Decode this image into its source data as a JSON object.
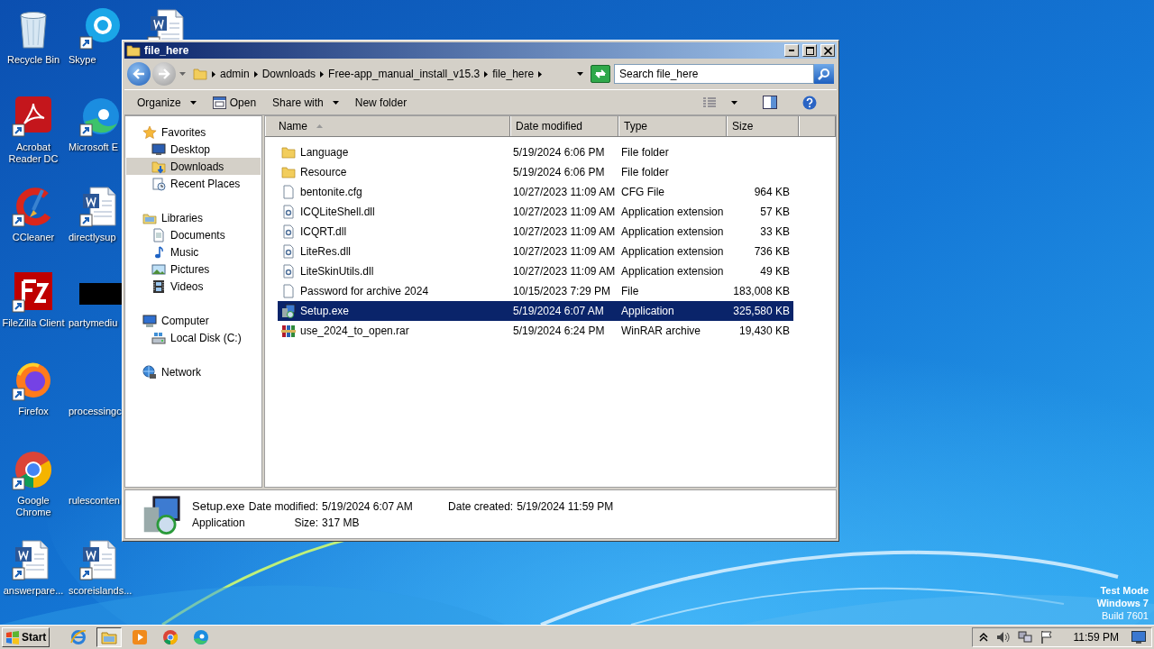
{
  "desktop": {
    "icons": [
      {
        "label": "Recycle Bin",
        "kind": "trash"
      },
      {
        "label": "Acrobat Reader DC",
        "kind": "acrobat"
      },
      {
        "label": "CCleaner",
        "kind": "ccleaner"
      },
      {
        "label": "FileZilla Client",
        "kind": "filezilla"
      },
      {
        "label": "Firefox",
        "kind": "firefox"
      },
      {
        "label": "Google Chrome",
        "kind": "chrome"
      },
      {
        "label": "answerpare...",
        "kind": "word"
      },
      {
        "label": "Skype",
        "kind": "skype"
      },
      {
        "label": "Microsoft E",
        "kind": "edge"
      },
      {
        "label": "directlysup",
        "kind": "word"
      },
      {
        "label": "partymediu",
        "kind": "black"
      },
      {
        "label": "processingc",
        "kind": "none"
      },
      {
        "label": "rulesconten",
        "kind": "none"
      },
      {
        "label": "scoreislands...",
        "kind": "word"
      },
      {
        "kind": "word"
      }
    ],
    "notice": [
      "Test Mode",
      "Windows 7",
      "Build 7601"
    ]
  },
  "window": {
    "title": "file_here",
    "address": [
      "admin",
      "Downloads",
      "Free-app_manual_install_v15.3",
      "file_here"
    ],
    "search": {
      "placeholder": "Search file_here"
    },
    "toolbar": [
      {
        "label": "Organize",
        "has_menu": true,
        "kind": "text"
      },
      {
        "label": "Open",
        "has_menu": false,
        "kind": "open"
      },
      {
        "label": "Share with",
        "has_menu": true,
        "kind": "text"
      },
      {
        "label": "New folder",
        "has_menu": false,
        "kind": "text"
      }
    ],
    "sidebar": [
      {
        "label": "Favorites",
        "kind": "star",
        "selected": false,
        "children": [
          {
            "label": "Desktop",
            "kind": "desktop",
            "selected": false
          },
          {
            "label": "Downloads",
            "kind": "downloads",
            "selected": true
          },
          {
            "label": "Recent Places",
            "kind": "recent",
            "selected": false
          }
        ]
      },
      {
        "label": "Libraries",
        "kind": "libraries",
        "selected": false,
        "children": [
          {
            "label": "Documents",
            "kind": "documents",
            "selected": false
          },
          {
            "label": "Music",
            "kind": "music",
            "selected": false
          },
          {
            "label": "Pictures",
            "kind": "pictures",
            "selected": false
          },
          {
            "label": "Videos",
            "kind": "videos",
            "selected": false
          }
        ]
      },
      {
        "label": "Computer",
        "kind": "computer",
        "selected": false,
        "children": [
          {
            "label": "Local Disk (C:)",
            "kind": "disk",
            "selected": false
          }
        ]
      },
      {
        "label": "Network",
        "kind": "network",
        "selected": false
      }
    ],
    "columns": [
      {
        "label": "Name",
        "sorted": true
      },
      {
        "label": "Date modified",
        "sorted": false
      },
      {
        "label": "Type",
        "sorted": false
      },
      {
        "label": "Size",
        "sorted": false
      }
    ],
    "rows": [
      {
        "name": "Language",
        "date": "5/19/2024 6:06 PM",
        "type": "File folder",
        "kind": "folder",
        "selected": false
      },
      {
        "name": "Resource",
        "date": "5/19/2024 6:06 PM",
        "type": "File folder",
        "kind": "folder",
        "selected": false
      },
      {
        "name": "bentonite.cfg",
        "date": "10/27/2023 11:09 AM",
        "type": "CFG File",
        "size": "964 KB",
        "kind": "file",
        "selected": false
      },
      {
        "name": "ICQLiteShell.dll",
        "date": "10/27/2023 11:09 AM",
        "type": "Application extension",
        "size": "57 KB",
        "kind": "dll",
        "selected": false
      },
      {
        "name": "ICQRT.dll",
        "date": "10/27/2023 11:09 AM",
        "type": "Application extension",
        "size": "33 KB",
        "kind": "dll",
        "selected": false
      },
      {
        "name": "LiteRes.dll",
        "date": "10/27/2023 11:09 AM",
        "type": "Application extension",
        "size": "736 KB",
        "kind": "dll",
        "selected": false
      },
      {
        "name": "LiteSkinUtils.dll",
        "date": "10/27/2023 11:09 AM",
        "type": "Application extension",
        "size": "49 KB",
        "kind": "dll",
        "selected": false
      },
      {
        "name": "Password for archive 2024",
        "date": "10/15/2023 7:29 PM",
        "type": "File",
        "size": "183,008 KB",
        "kind": "file",
        "selected": false
      },
      {
        "name": "Setup.exe",
        "date": "5/19/2024 6:07 AM",
        "type": "Application",
        "size": "325,580 KB",
        "kind": "exe",
        "selected": true
      },
      {
        "name": "use_2024_to_open.rar",
        "date": "5/19/2024 6:24 PM",
        "type": "WinRAR archive",
        "size": "19,430 KB",
        "kind": "rar",
        "selected": false
      }
    ],
    "details": {
      "name": "Setup.exe",
      "type": "Application",
      "kind": "exe",
      "fields": [
        {
          "label": "Date modified:",
          "value": "5/19/2024 6:07 AM"
        },
        {
          "label": "Date created:",
          "value": "5/19/2024 11:59 PM"
        },
        {
          "label": "Size:",
          "value": "317 MB"
        }
      ]
    }
  },
  "taskbar": {
    "start": "Start",
    "apps": [
      {
        "kind": "ie",
        "active": false
      },
      {
        "kind": "explorer",
        "active": true
      },
      {
        "kind": "media",
        "active": false
      },
      {
        "kind": "chrome",
        "active": false
      },
      {
        "kind": "edge",
        "active": false
      }
    ],
    "time": "11:59 PM"
  }
}
